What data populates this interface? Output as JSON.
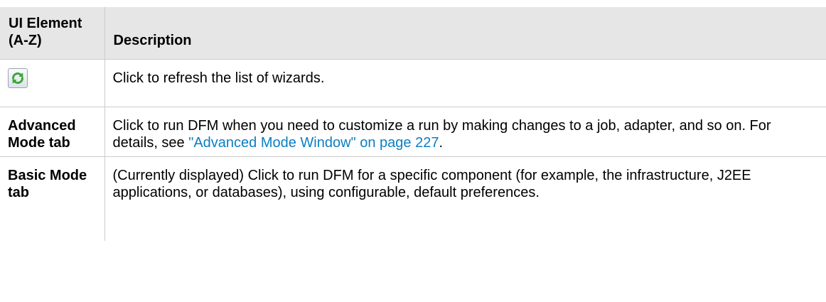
{
  "table": {
    "header": {
      "col1": "UI Element (A-Z)",
      "col2": "Description"
    },
    "rows": [
      {
        "element_icon": "refresh-icon",
        "description": "Click to refresh the list of wizards."
      },
      {
        "element": "Advanced Mode tab",
        "description_before": "Click to run DFM when you need to customize a run by making changes to a job, adapter, and so on. For details, see ",
        "link": "\"Advanced Mode Window\" on page 227",
        "description_after": "."
      },
      {
        "element": "Basic Mode tab",
        "description": "(Currently displayed) Click to run DFM for a specific component (for example, the infrastructure, J2EE applications, or databases), using configurable, default preferences."
      }
    ]
  },
  "colors": {
    "header_bg": "#e6e6e6",
    "border": "#cccccc",
    "link": "#0a7fc2",
    "icon_green": "#3aa63a"
  }
}
